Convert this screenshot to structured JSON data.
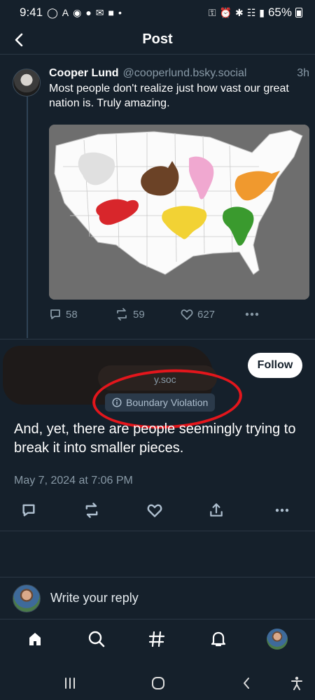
{
  "status_bar": {
    "time": "9:41",
    "battery": "65%",
    "left_icons": [
      "whatsapp-icon",
      "a-icon",
      "chrome-icon",
      "lock-icon",
      "email-icon",
      "linkedin-icon",
      "dot-icon"
    ],
    "right_icons": [
      "key-icon",
      "alarm-icon",
      "bluetooth-icon",
      "wifi-icon",
      "signal-icon",
      "battery-icon"
    ]
  },
  "header": {
    "title": "Post"
  },
  "parent_post": {
    "author_name": "Cooper Lund",
    "author_handle": "@cooperlund.bsky.social",
    "time": "3h",
    "text": "Most people don't realize just how vast our great nation is. Truly amazing.",
    "image": {
      "description_icon": "map-image",
      "continents": [
        {
          "name": "Antarctica",
          "color": "#e0e0e0"
        },
        {
          "name": "Australia",
          "color": "#6b4226"
        },
        {
          "name": "South America",
          "color": "#f0a8d0"
        },
        {
          "name": "North America",
          "color": "#f0992e"
        },
        {
          "name": "Europe",
          "color": "#d8262b"
        },
        {
          "name": "Asia",
          "color": "#f2d234"
        },
        {
          "name": "Africa",
          "color": "#3a9a2e"
        }
      ]
    },
    "replies": "58",
    "reposts": "59",
    "likes": "627"
  },
  "main_post": {
    "handle_fragment": "y.soc",
    "follow_label": "Follow",
    "label_text": "Boundary Violation",
    "text": "And, yet, there are people seemingly trying to break it into smaller pieces.",
    "date": "May 7, 2024 at 7:06 PM"
  },
  "reply_bar": {
    "placeholder": "Write your reply"
  },
  "colors": {
    "background": "#15202b",
    "divider": "#2a3744",
    "muted_text": "#8899a6",
    "annotation_circle": "#e3161c"
  }
}
